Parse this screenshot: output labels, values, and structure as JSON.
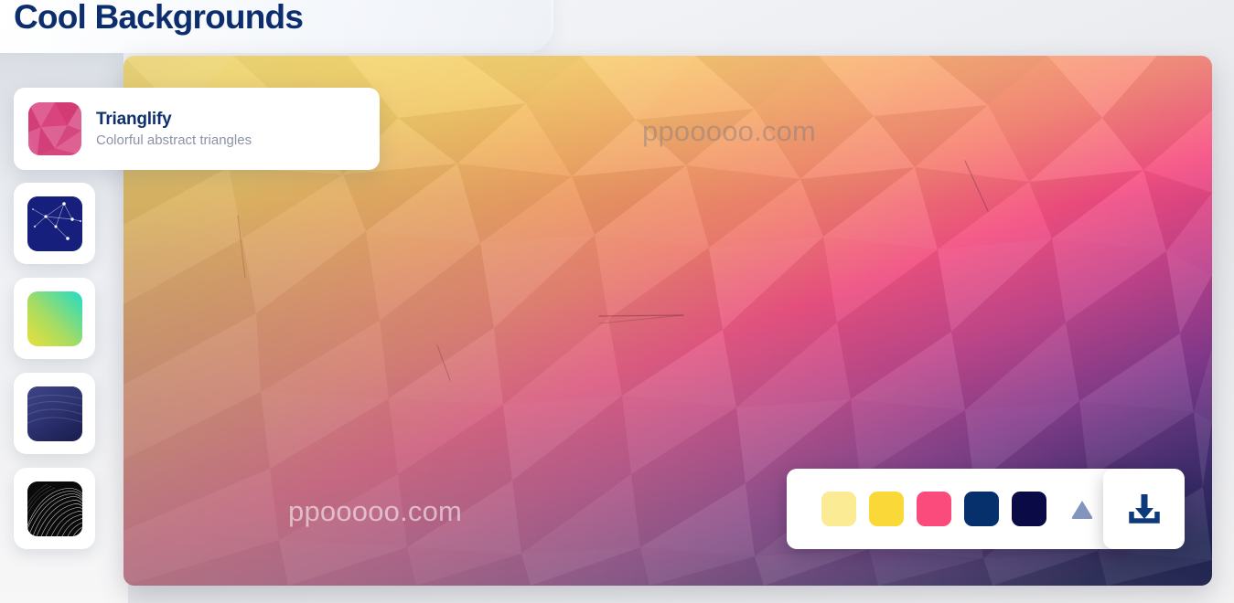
{
  "header": {
    "title": "Cool Backgrounds"
  },
  "info_card": {
    "name": "Trianglify",
    "description": "Colorful abstract triangles",
    "thumbnail_colors": [
      "#d9447e",
      "#e06a9c",
      "#c93a72",
      "#e87aa8"
    ]
  },
  "watermarks": {
    "top": "ppooooo.com",
    "middle": "ppooooo.com"
  },
  "sidebar": {
    "items": [
      {
        "name": "Particles",
        "icon": "constellation-network-icon",
        "colors": [
          "#15207a",
          "#1b2a8c",
          "#ffffff"
        ]
      },
      {
        "name": "Gradient",
        "icon": "gradient-swatch-icon",
        "colors": [
          "#eede3e",
          "#9ed96a",
          "#25d9c4"
        ]
      },
      {
        "name": "Fog",
        "icon": "fog-mesh-icon",
        "colors": [
          "#2b2f6e",
          "#3a4080",
          "#1e224f"
        ]
      },
      {
        "name": "Topography",
        "icon": "topography-lines-icon",
        "colors": [
          "#000000",
          "#ffffff",
          "#9a9a9a"
        ]
      }
    ]
  },
  "toolbar": {
    "swatches": [
      {
        "name": "pale-yellow",
        "color": "#fbeb95"
      },
      {
        "name": "yellow",
        "color": "#fad838"
      },
      {
        "name": "pink",
        "color": "#fa4b7c"
      },
      {
        "name": "navy-blue",
        "color": "#05306b"
      },
      {
        "name": "midnight-navy",
        "color": "#0a0a46"
      }
    ],
    "shape_toggle": {
      "icon": "triangle-icon",
      "color": "#8495bd"
    },
    "download": {
      "label": "Download",
      "icon": "download-icon",
      "color": "#0d3a7a"
    }
  },
  "canvas": {
    "style": "low-poly-triangles",
    "gradient_stops": [
      "#fcd946",
      "#f9a04f",
      "#fa6f72",
      "#f53c7e",
      "#a93a8e",
      "#6d2f86",
      "#2a1f63",
      "#0d1449"
    ]
  }
}
